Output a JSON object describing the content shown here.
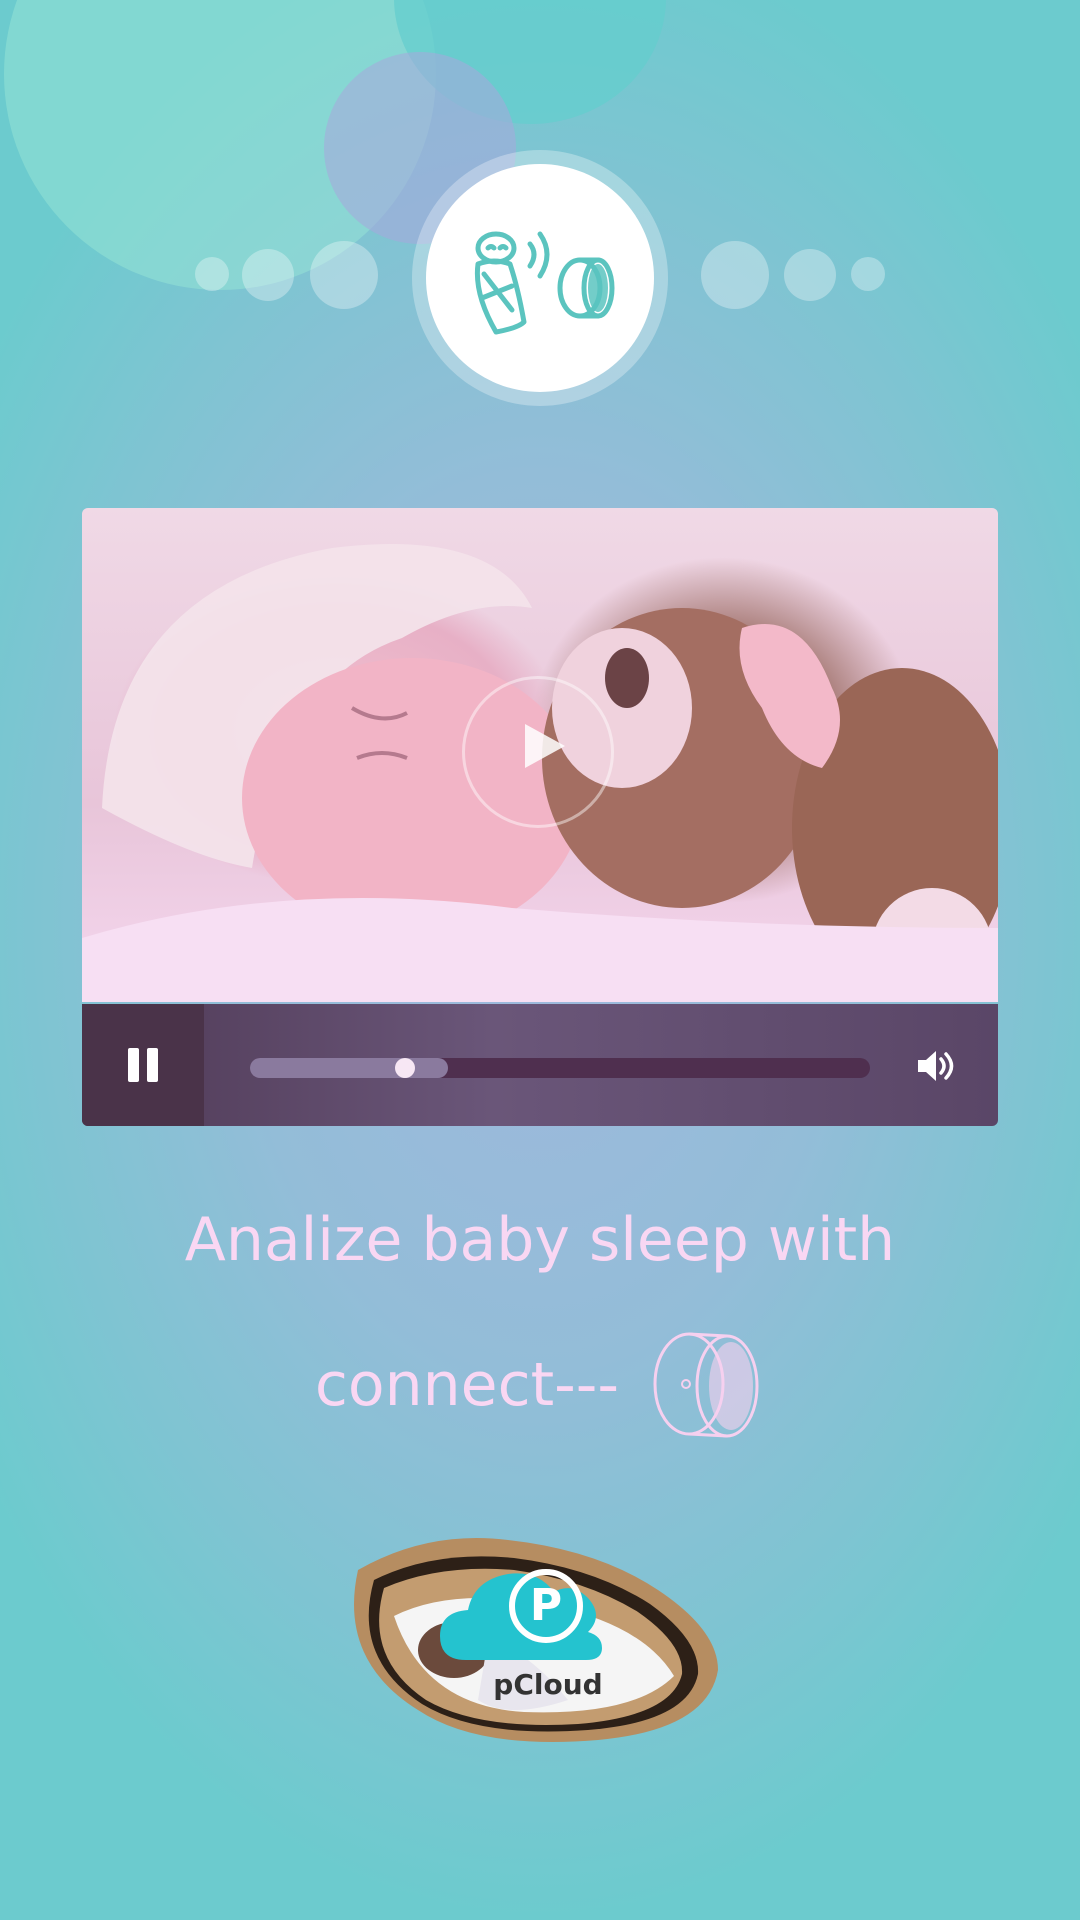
{
  "hero_icon": "baby-sensor-icon",
  "video": {
    "play_icon": "play-icon",
    "pause_icon": "pause-icon",
    "volume_icon": "volume-icon",
    "progress": 0.32
  },
  "headline": {
    "line1": "Analize baby sleep with",
    "line2": "connect---",
    "device_icon": "sensor-band-icon"
  },
  "pcloud": {
    "label": "pCloud",
    "letter": "P"
  }
}
